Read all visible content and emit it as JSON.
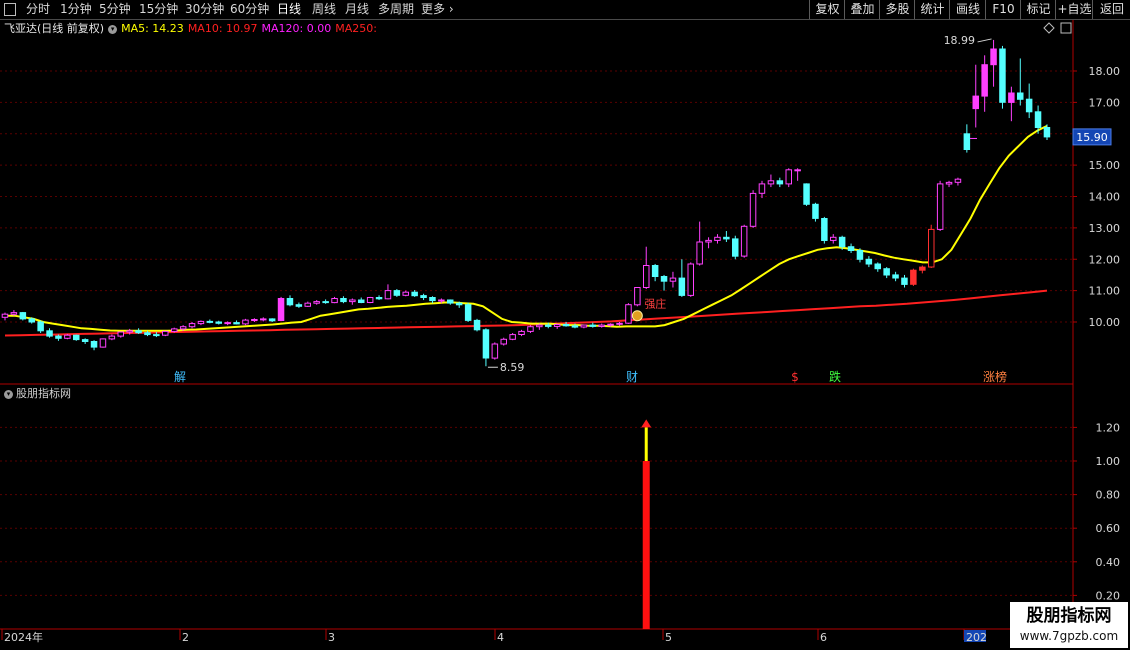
{
  "toolbar": {
    "periods": [
      "分时",
      "1分钟",
      "5分钟",
      "15分钟",
      "30分钟",
      "60分钟",
      "日线",
      "周线",
      "月线",
      "多周期",
      "更多"
    ],
    "active_period": "日线",
    "right_buttons": [
      "复权",
      "叠加",
      "多股",
      "统计",
      "画线",
      "F10",
      "标记",
      "+自选",
      "返回"
    ]
  },
  "stock": {
    "title": "飞亚达(日线 前复权)"
  },
  "ma_legend": [
    {
      "label": "MA5: 14.23",
      "color": "#ffff00"
    },
    {
      "label": "MA10: 10.97",
      "color": "#ff2020"
    },
    {
      "label": "MA120: 0.00",
      "color": "#ff20ff"
    },
    {
      "label": "MA250:",
      "color": "#ff2020"
    }
  ],
  "indicator": {
    "title": "股朋指标网",
    "axis": [
      "1.20",
      "1.00",
      "0.80",
      "0.60",
      "0.40",
      "0.20"
    ],
    "signal_value": 1.0
  },
  "price_axis": {
    "labels": [
      "18.00",
      "17.00",
      "15.00",
      "14.00",
      "13.00",
      "12.00",
      "11.00",
      "10.00"
    ],
    "current_price": "15.90"
  },
  "annotations": {
    "high": "18.99",
    "low": "8.59",
    "events": [
      {
        "text": "解",
        "color": "#40c0ff"
      },
      {
        "text": "财",
        "color": "#40c0ff"
      },
      {
        "text": "$",
        "color": "#ff3030"
      },
      {
        "text": "跌",
        "color": "#40ff40"
      },
      {
        "text": "涨榜",
        "color": "#ff8040"
      }
    ],
    "tag": "强庄"
  },
  "time_axis": [
    "2024年",
    "2",
    "3",
    "4",
    "5",
    "6",
    "202"
  ],
  "watermark": {
    "title": "股朋指标网",
    "url": "www.7gpzb.com"
  },
  "colors": {
    "up": "#ff3030",
    "up_hollow_pink": "#ff40ff",
    "down": "#54ffff",
    "ma5": "#ffff00",
    "ma10": "#ff2020",
    "grid": "#5a0000",
    "axis": "#b00000"
  },
  "chart_data": {
    "type": "candlestick",
    "ohlc": [
      [
        10.15,
        10.3,
        10.05,
        10.25
      ],
      [
        10.25,
        10.38,
        10.2,
        10.3
      ],
      [
        10.3,
        10.32,
        10.05,
        10.1
      ],
      [
        10.1,
        10.15,
        9.95,
        10.0
      ],
      [
        10.0,
        10.05,
        9.65,
        9.72
      ],
      [
        9.72,
        9.8,
        9.5,
        9.55
      ],
      [
        9.55,
        9.6,
        9.4,
        9.48
      ],
      [
        9.48,
        9.62,
        9.45,
        9.58
      ],
      [
        9.58,
        9.6,
        9.4,
        9.44
      ],
      [
        9.44,
        9.48,
        9.3,
        9.38
      ],
      [
        9.38,
        9.42,
        9.1,
        9.2
      ],
      [
        9.2,
        9.48,
        9.18,
        9.46
      ],
      [
        9.46,
        9.6,
        9.42,
        9.55
      ],
      [
        9.55,
        9.7,
        9.5,
        9.68
      ],
      [
        9.68,
        9.78,
        9.6,
        9.72
      ],
      [
        9.72,
        9.8,
        9.62,
        9.66
      ],
      [
        9.66,
        9.72,
        9.55,
        9.6
      ],
      [
        9.6,
        9.68,
        9.52,
        9.58
      ],
      [
        9.58,
        9.72,
        9.55,
        9.7
      ],
      [
        9.7,
        9.82,
        9.66,
        9.78
      ],
      [
        9.78,
        9.9,
        9.72,
        9.85
      ],
      [
        9.85,
        10.0,
        9.8,
        9.95
      ],
      [
        9.95,
        10.05,
        9.9,
        10.02
      ],
      [
        10.02,
        10.08,
        9.96,
        10.0
      ],
      [
        10.0,
        10.04,
        9.92,
        9.96
      ],
      [
        9.96,
        10.02,
        9.9,
        9.98
      ],
      [
        9.98,
        10.05,
        9.92,
        9.94
      ],
      [
        9.94,
        10.1,
        9.9,
        10.06
      ],
      [
        10.06,
        10.12,
        10.0,
        10.08
      ],
      [
        10.08,
        10.15,
        10.02,
        10.1
      ],
      [
        10.1,
        10.12,
        10.0,
        10.04
      ],
      [
        10.05,
        10.8,
        10.05,
        10.75
      ],
      [
        10.75,
        10.85,
        10.5,
        10.55
      ],
      [
        10.55,
        10.62,
        10.45,
        10.5
      ],
      [
        10.5,
        10.65,
        10.48,
        10.6
      ],
      [
        10.6,
        10.7,
        10.55,
        10.65
      ],
      [
        10.65,
        10.72,
        10.58,
        10.62
      ],
      [
        10.62,
        10.8,
        10.6,
        10.75
      ],
      [
        10.75,
        10.82,
        10.6,
        10.65
      ],
      [
        10.65,
        10.75,
        10.55,
        10.7
      ],
      [
        10.7,
        10.78,
        10.6,
        10.62
      ],
      [
        10.62,
        10.8,
        10.6,
        10.78
      ],
      [
        10.78,
        10.85,
        10.7,
        10.74
      ],
      [
        10.74,
        11.2,
        10.72,
        11.0
      ],
      [
        11.0,
        11.05,
        10.8,
        10.85
      ],
      [
        10.85,
        11.0,
        10.82,
        10.95
      ],
      [
        10.95,
        11.02,
        10.8,
        10.84
      ],
      [
        10.84,
        10.9,
        10.7,
        10.78
      ],
      [
        10.78,
        10.82,
        10.6,
        10.68
      ],
      [
        10.68,
        10.75,
        10.6,
        10.7
      ],
      [
        10.7,
        10.72,
        10.55,
        10.6
      ],
      [
        10.6,
        10.65,
        10.45,
        10.55
      ],
      [
        10.55,
        10.62,
        10.0,
        10.05
      ],
      [
        10.05,
        10.1,
        9.7,
        9.75
      ],
      [
        9.75,
        9.8,
        8.59,
        8.85
      ],
      [
        8.85,
        9.35,
        8.8,
        9.3
      ],
      [
        9.3,
        9.5,
        9.25,
        9.45
      ],
      [
        9.45,
        9.65,
        9.42,
        9.6
      ],
      [
        9.6,
        9.75,
        9.55,
        9.7
      ],
      [
        9.7,
        9.9,
        9.65,
        9.85
      ],
      [
        9.85,
        9.95,
        9.75,
        9.9
      ],
      [
        9.9,
        9.98,
        9.8,
        9.86
      ],
      [
        9.86,
        9.95,
        9.78,
        9.92
      ],
      [
        9.92,
        10.0,
        9.85,
        9.88
      ],
      [
        9.88,
        9.95,
        9.8,
        9.84
      ],
      [
        9.84,
        9.92,
        9.8,
        9.9
      ],
      [
        9.9,
        9.98,
        9.82,
        9.86
      ],
      [
        9.86,
        9.95,
        9.82,
        9.9
      ],
      [
        9.9,
        9.96,
        9.85,
        9.93
      ],
      [
        9.93,
        10.0,
        9.88,
        9.96
      ],
      [
        9.96,
        10.6,
        9.94,
        10.55
      ],
      [
        10.55,
        11.1,
        10.5,
        11.1
      ],
      [
        11.1,
        12.4,
        11.05,
        11.8
      ],
      [
        11.8,
        11.85,
        11.3,
        11.45
      ],
      [
        11.45,
        11.5,
        11.0,
        11.3
      ],
      [
        11.3,
        11.6,
        11.1,
        11.4
      ],
      [
        11.4,
        12.0,
        10.8,
        10.85
      ],
      [
        10.85,
        11.9,
        10.8,
        11.85
      ],
      [
        11.85,
        13.2,
        11.8,
        12.55
      ],
      [
        12.55,
        12.7,
        12.35,
        12.6
      ],
      [
        12.6,
        12.8,
        12.5,
        12.7
      ],
      [
        12.7,
        12.9,
        12.55,
        12.65
      ],
      [
        12.65,
        12.75,
        12.0,
        12.1
      ],
      [
        12.1,
        13.1,
        12.05,
        13.05
      ],
      [
        13.05,
        14.2,
        13.0,
        14.1
      ],
      [
        14.1,
        14.5,
        13.95,
        14.4
      ],
      [
        14.4,
        14.7,
        14.3,
        14.5
      ],
      [
        14.5,
        14.6,
        14.3,
        14.4
      ],
      [
        14.4,
        14.9,
        14.3,
        14.85
      ],
      [
        14.85,
        14.9,
        14.5,
        14.85
      ],
      [
        14.4,
        14.42,
        13.7,
        13.75
      ],
      [
        13.75,
        13.8,
        13.2,
        13.3
      ],
      [
        13.3,
        13.35,
        12.5,
        12.6
      ],
      [
        12.6,
        12.8,
        12.5,
        12.7
      ],
      [
        12.7,
        12.75,
        12.3,
        12.4
      ],
      [
        12.4,
        12.5,
        12.2,
        12.28
      ],
      [
        12.28,
        12.35,
        11.9,
        12.0
      ],
      [
        12.0,
        12.1,
        11.75,
        11.85
      ],
      [
        11.85,
        11.9,
        11.6,
        11.7
      ],
      [
        11.7,
        11.75,
        11.4,
        11.5
      ],
      [
        11.5,
        11.6,
        11.3,
        11.4
      ],
      [
        11.4,
        11.5,
        11.1,
        11.2
      ],
      [
        11.2,
        11.7,
        11.15,
        11.65
      ],
      [
        11.65,
        11.8,
        11.55,
        11.75
      ],
      [
        11.75,
        13.1,
        11.72,
        12.95
      ],
      [
        12.95,
        14.5,
        12.9,
        14.4
      ],
      [
        14.4,
        14.5,
        14.3,
        14.45
      ],
      [
        14.45,
        14.6,
        14.35,
        14.55
      ],
      [
        16.0,
        16.3,
        15.4,
        15.5
      ],
      [
        16.8,
        18.2,
        16.2,
        17.2
      ],
      [
        17.2,
        18.5,
        16.7,
        18.2
      ],
      [
        18.2,
        18.99,
        17.5,
        18.7
      ],
      [
        18.7,
        18.8,
        16.8,
        17.0
      ],
      [
        17.0,
        17.5,
        16.4,
        17.3
      ],
      [
        17.3,
        18.4,
        16.9,
        17.1
      ],
      [
        17.1,
        17.6,
        16.5,
        16.7
      ],
      [
        16.7,
        16.9,
        16.0,
        16.2
      ],
      [
        16.2,
        16.3,
        15.8,
        15.9
      ]
    ],
    "ma5": [
      10.2,
      10.2,
      10.15,
      10.1,
      10.0,
      9.95,
      9.9,
      9.85,
      9.8,
      9.78,
      9.75,
      9.73,
      9.72,
      9.72,
      9.72,
      9.72,
      9.72,
      9.72,
      9.73,
      9.75,
      9.76,
      9.78,
      9.8,
      9.82,
      9.84,
      9.86,
      9.88,
      9.9,
      9.92,
      9.95,
      9.98,
      10.0,
      10.1,
      10.2,
      10.25,
      10.3,
      10.35,
      10.4,
      10.42,
      10.45,
      10.48,
      10.5,
      10.52,
      10.55,
      10.58,
      10.6,
      10.62,
      10.62,
      10.6,
      10.58,
      10.5,
      10.3,
      10.1,
      10.0,
      9.98,
      9.95,
      9.95,
      9.95,
      9.92,
      9.9,
      9.9,
      9.88,
      9.88,
      9.87,
      9.85,
      9.86,
      9.86,
      9.86,
      9.86,
      9.9,
      10.0,
      10.1,
      10.25,
      10.4,
      10.55,
      10.7,
      10.85,
      11.05,
      11.25,
      11.45,
      11.65,
      11.85,
      12.0,
      12.1,
      12.2,
      12.3,
      12.35,
      12.38,
      12.35,
      12.3,
      12.25,
      12.2,
      12.12,
      12.05,
      12.0,
      11.95,
      11.9,
      11.9,
      12.0,
      12.3,
      12.8,
      13.3,
      13.9,
      14.4,
      14.9,
      15.3,
      15.6,
      15.9,
      16.1,
      16.25
    ],
    "ma10": [
      9.57,
      9.58,
      9.59,
      9.6,
      9.61,
      9.62,
      9.63,
      9.64,
      9.65,
      9.66,
      9.67,
      9.68,
      9.69,
      9.7,
      9.71,
      9.72,
      9.73,
      9.74,
      9.75,
      9.76,
      9.77,
      9.78,
      9.79,
      9.8,
      9.81,
      9.82,
      9.83,
      9.84,
      9.85,
      9.86,
      9.87,
      9.88,
      9.89,
      9.9,
      9.92,
      9.94,
      9.96,
      9.98,
      10.0,
      10.02,
      10.05,
      10.08,
      10.11,
      10.14,
      10.17,
      10.2,
      10.23,
      10.26,
      10.29,
      10.32,
      10.35,
      10.38,
      10.41,
      10.44,
      10.47,
      10.5,
      10.52,
      10.55,
      10.58,
      10.62,
      10.66,
      10.7,
      10.75,
      10.8,
      10.85,
      10.9,
      10.95,
      11.0
    ]
  }
}
